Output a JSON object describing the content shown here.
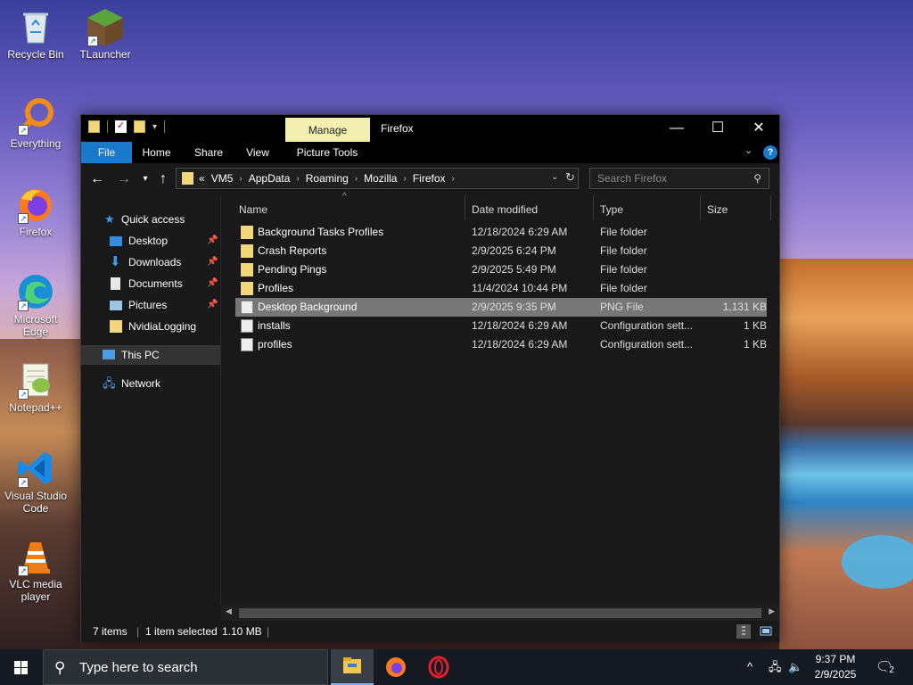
{
  "desktop": {
    "icons": [
      {
        "label": "Recycle Bin"
      },
      {
        "label": "TLauncher"
      },
      {
        "label": "Everything"
      },
      {
        "label": "Firefox"
      },
      {
        "label": "Microsoft Edge"
      },
      {
        "label": "Notepad++"
      },
      {
        "label": "Visual Studio Code"
      },
      {
        "label": "VLC media player"
      }
    ]
  },
  "window": {
    "title": "Firefox",
    "context_tab": "Manage",
    "ribbon_tabs": [
      "File",
      "Home",
      "Share",
      "View",
      "Picture Tools"
    ],
    "address_crumbs": [
      "VM5",
      "AppData",
      "Roaming",
      "Mozilla",
      "Firefox"
    ],
    "address_overflow": "«",
    "search_placeholder": "Search Firefox",
    "nav": {
      "quick_access": "Quick access",
      "items": [
        "Desktop",
        "Downloads",
        "Documents",
        "Pictures",
        "NvidiaLogging"
      ],
      "this_pc": "This PC",
      "network": "Network"
    },
    "columns": [
      "Name",
      "Date modified",
      "Type",
      "Size"
    ],
    "files": [
      {
        "name": "Background Tasks Profiles",
        "date": "12/18/2024 6:29 AM",
        "type": "File folder",
        "size": "",
        "kind": "folder"
      },
      {
        "name": "Crash Reports",
        "date": "2/9/2025 6:24 PM",
        "type": "File folder",
        "size": "",
        "kind": "folder"
      },
      {
        "name": "Pending Pings",
        "date": "2/9/2025 5:49 PM",
        "type": "File folder",
        "size": "",
        "kind": "folder"
      },
      {
        "name": "Profiles",
        "date": "11/4/2024 10:44 PM",
        "type": "File folder",
        "size": "",
        "kind": "folder"
      },
      {
        "name": "Desktop Background",
        "date": "2/9/2025 9:35 PM",
        "type": "PNG File",
        "size": "1,131 KB",
        "kind": "file"
      },
      {
        "name": "installs",
        "date": "12/18/2024 6:29 AM",
        "type": "Configuration sett...",
        "size": "1 KB",
        "kind": "file"
      },
      {
        "name": "profiles",
        "date": "12/18/2024 6:29 AM",
        "type": "Configuration sett...",
        "size": "1 KB",
        "kind": "file"
      }
    ],
    "selected_index": 4,
    "status": {
      "items": "7 items",
      "selected": "1 item selected",
      "size": "1.10 MB"
    }
  },
  "taskbar": {
    "search_placeholder": "Type here to search",
    "time": "9:37 PM",
    "date": "2/9/2025",
    "notifications": "2"
  },
  "colors": {
    "accent": "#1979ca",
    "manage_tab": "#f2efb0",
    "folder": "#f2d77b",
    "selected_row": "#777777"
  }
}
